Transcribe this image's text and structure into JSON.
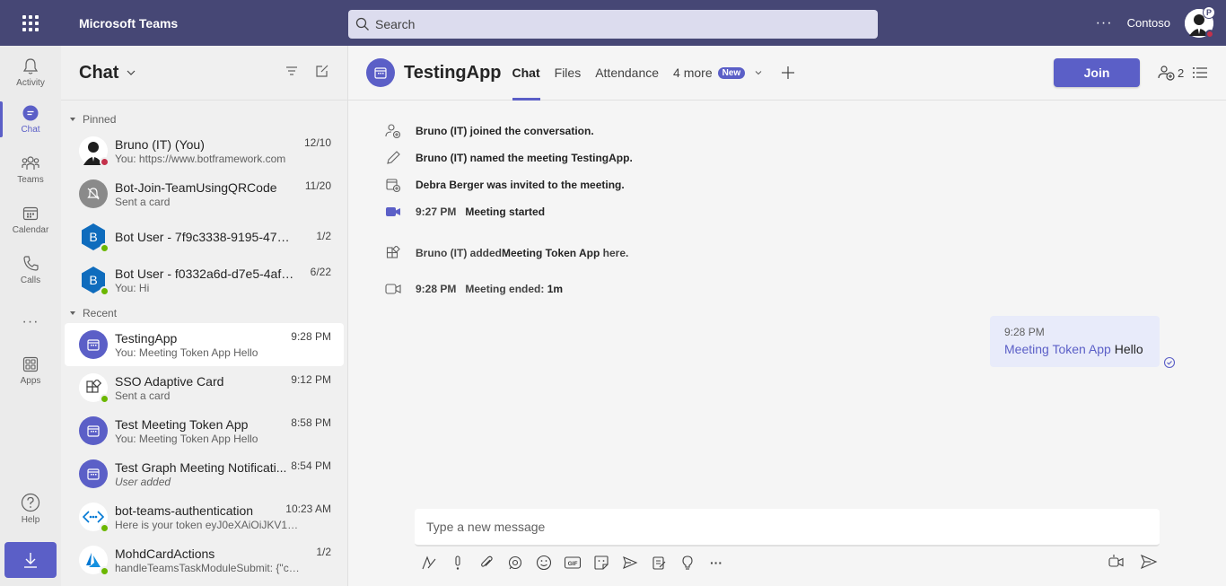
{
  "app": {
    "title": "Microsoft Teams",
    "search_placeholder": "Search",
    "org_name": "Contoso",
    "avatar_badge": "P"
  },
  "rail": {
    "items": [
      {
        "label": "Activity",
        "icon": "bell-icon"
      },
      {
        "label": "Chat",
        "icon": "chat-icon"
      },
      {
        "label": "Teams",
        "icon": "teams-icon"
      },
      {
        "label": "Calendar",
        "icon": "calendar-icon"
      },
      {
        "label": "Calls",
        "icon": "phone-icon"
      },
      {
        "label": "Apps",
        "icon": "apps-icon"
      },
      {
        "label": "Help",
        "icon": "help-icon"
      }
    ]
  },
  "chatlist": {
    "title": "Chat",
    "pinned_label": "Pinned",
    "recent_label": "Recent",
    "pinned": [
      {
        "name": "Bruno (IT) (You)",
        "preview": "You: https://www.botframework.com",
        "time": "12/10"
      },
      {
        "name": "Bot-Join-TeamUsingQRCode",
        "preview": "Sent a card",
        "time": "11/20"
      },
      {
        "name": "Bot User - 7f9c3338-9195-47ce-b...",
        "preview": "",
        "time": "1/2",
        "initial": "B"
      },
      {
        "name": "Bot User - f0332a6d-d7e5-4af4-...",
        "preview": "You: Hi",
        "time": "6/22",
        "initial": "B"
      }
    ],
    "recent": [
      {
        "name": "TestingApp",
        "preview": "You: Meeting Token App Hello",
        "time": "9:28 PM"
      },
      {
        "name": "SSO Adaptive Card",
        "preview": "Sent a card",
        "time": "9:12 PM"
      },
      {
        "name": "Test Meeting Token App",
        "preview": "You: Meeting Token App Hello",
        "time": "8:58 PM"
      },
      {
        "name": "Test Graph Meeting Notificati...",
        "preview": "User added",
        "time": "8:54 PM"
      },
      {
        "name": "bot-teams-authentication",
        "preview": "Here is your token eyJ0eXAiOiJKV1QiL...",
        "time": "10:23 AM"
      },
      {
        "name": "MohdCardActions",
        "preview": "handleTeamsTaskModuleSubmit: {\"comm...",
        "time": "1/2"
      }
    ]
  },
  "main": {
    "title": "TestingApp",
    "tabs": [
      "Chat",
      "Files",
      "Attendance",
      "4 more"
    ],
    "new_badge": "New",
    "join_label": "Join",
    "participant_count": "2",
    "events": [
      {
        "text": "Bruno (IT) joined the conversation."
      },
      {
        "text": "Bruno (IT) named the meeting TestingApp."
      },
      {
        "text": "Debra Berger was invited to the meeting."
      },
      {
        "time": "9:27 PM",
        "text": "Meeting started"
      },
      {
        "pre": "Bruno (IT) added ",
        "bold": "Meeting Token App",
        "post": " here."
      },
      {
        "time": "9:28 PM",
        "text": "Meeting ended: ",
        "bold": "1m"
      }
    ],
    "message": {
      "time": "9:28 PM",
      "mention": "Meeting Token App",
      "text": " Hello"
    },
    "compose_placeholder": "Type a new message"
  }
}
